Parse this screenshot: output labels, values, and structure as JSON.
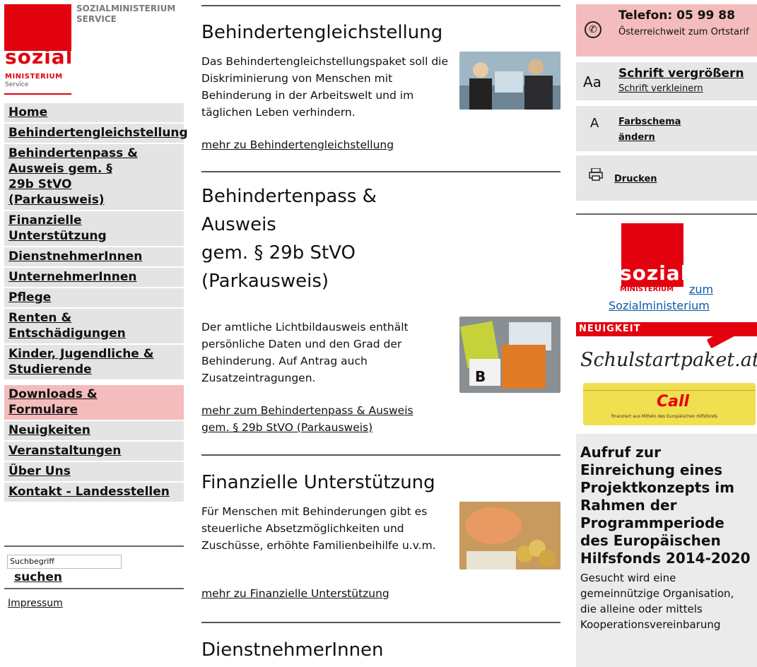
{
  "logo": {
    "tagline": "SOZIALMINISTERIUM SERVICE",
    "word": "sozial",
    "sub": "MINISTERIUM",
    "service": "Service",
    "brand_color": "#e3000f"
  },
  "nav": {
    "items": [
      {
        "label": "Home"
      },
      {
        "label": "Behindertengleichstellung"
      },
      {
        "label": "Behindertenpass & Ausweis gem. § 29b StVO (Parkausweis)"
      },
      {
        "label": "Finanzielle Unterstützung"
      },
      {
        "label": "DienstnehmerInnen"
      },
      {
        "label": "UnternehmerInnen"
      },
      {
        "label": "Pflege"
      },
      {
        "label": "Renten & Entschädigungen"
      },
      {
        "label": "Kinder, Jugendliche & Studierende"
      },
      {
        "label": "Downloads & Formulare"
      },
      {
        "label": "Neuigkeiten"
      },
      {
        "label": "Veranstaltungen"
      },
      {
        "label": "Über Uns"
      },
      {
        "label": "Kontakt - Landesstellen"
      }
    ],
    "active_color": "#f4bcbc"
  },
  "search": {
    "placeholder": "Suchbegriff",
    "button": "suchen"
  },
  "impressum": "Impressum",
  "sections": [
    {
      "title": "Behindertengleichstellung",
      "text": "Das Behindertengleichstellungspaket soll die Diskriminierung von Menschen mit Behinderung in der Arbeitswelt und im täglichen Leben verhindern.",
      "link": "mehr zu Behindertengleichstellung"
    },
    {
      "title_lines": [
        "Behindertenpass &",
        "Ausweis",
        "gem. § 29b StVO",
        "(Parkausweis)"
      ],
      "text": "Der amtliche Lichtbildausweis enthält persönliche Daten und den Grad der Behinderung. Auf Antrag auch Zusatzeintragungen.",
      "link_lines": [
        "mehr zum Behindertenpass & Ausweis",
        "gem. § 29b StVO (Parkausweis)"
      ]
    },
    {
      "title": "Finanzielle Unterstützung",
      "text": "Für Menschen mit Behinderungen gibt es steuerliche Absetzmöglichkeiten und Zuschüsse, erhöhte Familienbeihilfe u.v.m.",
      "link": "mehr zu Finanzielle Unterstützung"
    },
    {
      "title": "DienstnehmerInnen"
    }
  ],
  "sidebar": {
    "phone_title": "Telefon: 05 99 88",
    "phone_sub": "Österreichweit zum Ortstarif",
    "font_larger": "Schrift vergrößern",
    "font_smaller": "Schrift verkleinern",
    "font_icon": "Aa",
    "color_scheme": "Farbschema ändern",
    "color_icon": "A",
    "print": "Drucken",
    "zum": "zum",
    "ministry_link": "Sozialministerium",
    "news_label": "NEUIGKEIT",
    "promo_brand": "Schulstartpaket.at",
    "promo_call": "Call",
    "promo_fund": "finanziert aus Mitteln des Europäischen Hilfsfonds",
    "news_title": "Aufruf zur Einreichung eines Projektkonzepts im Rahmen der Programmperiode des Europäischen Hilfsfonds 2014-2020",
    "news_text": "Gesucht wird eine gemeinnützige Organisation, die alleine oder mittels Kooperationsvereinbarung"
  }
}
